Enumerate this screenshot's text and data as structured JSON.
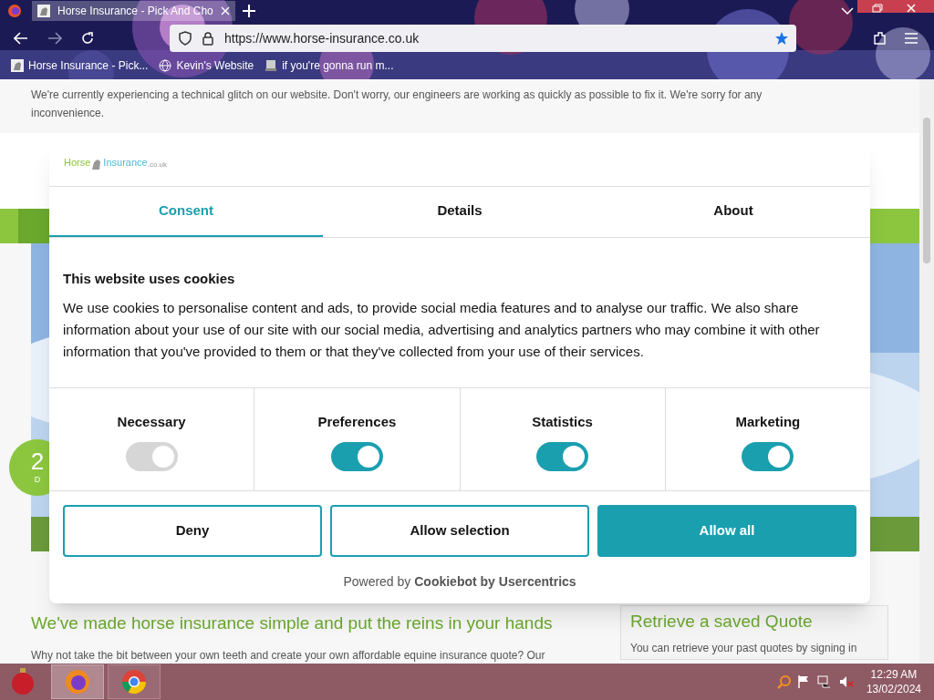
{
  "browser": {
    "tabs": [
      {
        "title": "Horse Insurance - Pick And Cho",
        "selected": true
      }
    ],
    "url": "https://www.horse-insurance.co.uk",
    "bookmarks": [
      "Horse Insurance - Pick...",
      "Kevin's Website",
      "if you're gonna run m..."
    ]
  },
  "page": {
    "notice": "We're currently experiencing a technical glitch on our website. Don't worry, our engineers are working as quickly as possible to fix it. We're sorry for any inconvenience.",
    "badge_number": "2",
    "badge_text": "D",
    "heading": "We've made horse insurance simple and put the reins in your hands",
    "intro": "Why not take the bit between your own teeth and create your own affordable equine insurance quote? Our",
    "sidebar": {
      "title": "Retrieve a saved Quote",
      "text": "You can retrieve your past quotes by signing in"
    }
  },
  "cookie_dialog": {
    "logo": {
      "horse": "Horse",
      "insurance": "Insurance",
      "suffix": ".co.uk"
    },
    "tabs": [
      {
        "label": "Consent",
        "selected": true
      },
      {
        "label": "Details",
        "selected": false
      },
      {
        "label": "About",
        "selected": false
      }
    ],
    "heading": "This website uses cookies",
    "text": "We use cookies to personalise content and ads, to provide social media features and to analyse our traffic. We also share information about your use of our site with our social media, advertising and analytics partners who may combine it with other information that you've provided to them or that they've collected from your use of their services.",
    "categories": [
      {
        "label": "Necessary",
        "on": true,
        "disabled": true
      },
      {
        "label": "Preferences",
        "on": true,
        "disabled": false
      },
      {
        "label": "Statistics",
        "on": true,
        "disabled": false
      },
      {
        "label": "Marketing",
        "on": true,
        "disabled": false
      }
    ],
    "buttons": [
      {
        "label": "Deny",
        "kind": "outline"
      },
      {
        "label": "Allow selection",
        "kind": "outline"
      },
      {
        "label": "Allow all",
        "kind": "filled"
      }
    ],
    "powered_by": "Powered by **Cookiebot by Usercentrics**"
  },
  "taskbar": {
    "time": "12:29 AM",
    "date": "13/02/2024"
  }
}
